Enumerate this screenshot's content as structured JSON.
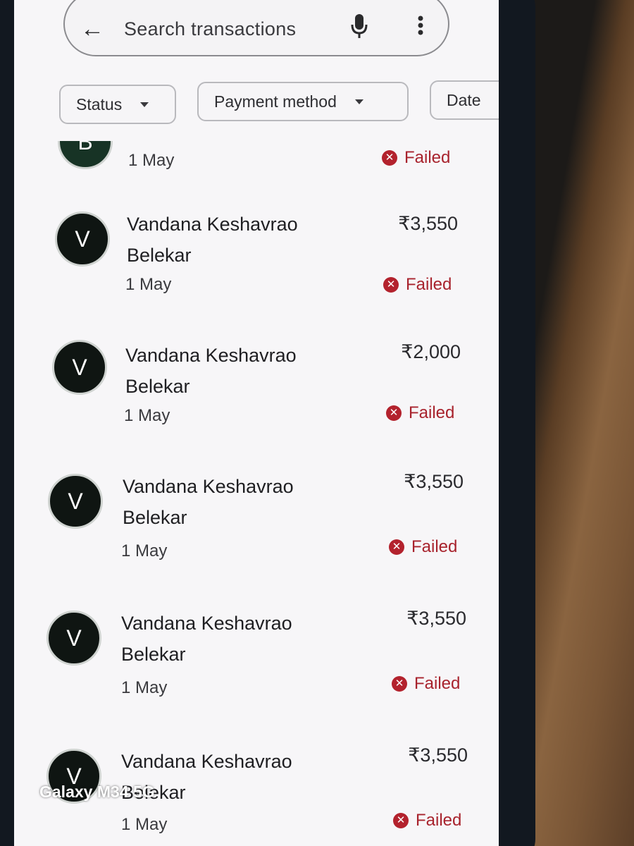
{
  "search": {
    "placeholder": "Search transactions"
  },
  "filters": {
    "status": "Status",
    "payment_method": "Payment method",
    "date": "Date"
  },
  "transactions": [
    {
      "avatar": "B",
      "name": "",
      "name2": "",
      "date": "1 May",
      "amount": "",
      "status": "Failed"
    },
    {
      "avatar": "V",
      "name": "Vandana Keshavrao",
      "name2": "Belekar",
      "date": "1 May",
      "amount": "₹3,550",
      "status": "Failed"
    },
    {
      "avatar": "V",
      "name": "Vandana Keshavrao",
      "name2": "Belekar",
      "date": "1 May",
      "amount": "₹2,000",
      "status": "Failed"
    },
    {
      "avatar": "V",
      "name": "Vandana Keshavrao",
      "name2": "Belekar",
      "date": "1 May",
      "amount": "₹3,550",
      "status": "Failed"
    },
    {
      "avatar": "V",
      "name": "Vandana Keshavrao",
      "name2": "Belekar",
      "date": "1 May",
      "amount": "₹3,550",
      "status": "Failed"
    },
    {
      "avatar": "V",
      "name": "Vandana Keshavrao",
      "name2": "Belekar",
      "date": "1 May",
      "amount": "₹3,550",
      "status": "Failed"
    }
  ],
  "watermark": "Galaxy M34 5G",
  "colors": {
    "failed": "#b3222d",
    "avatar_bg": "#0f1512"
  }
}
